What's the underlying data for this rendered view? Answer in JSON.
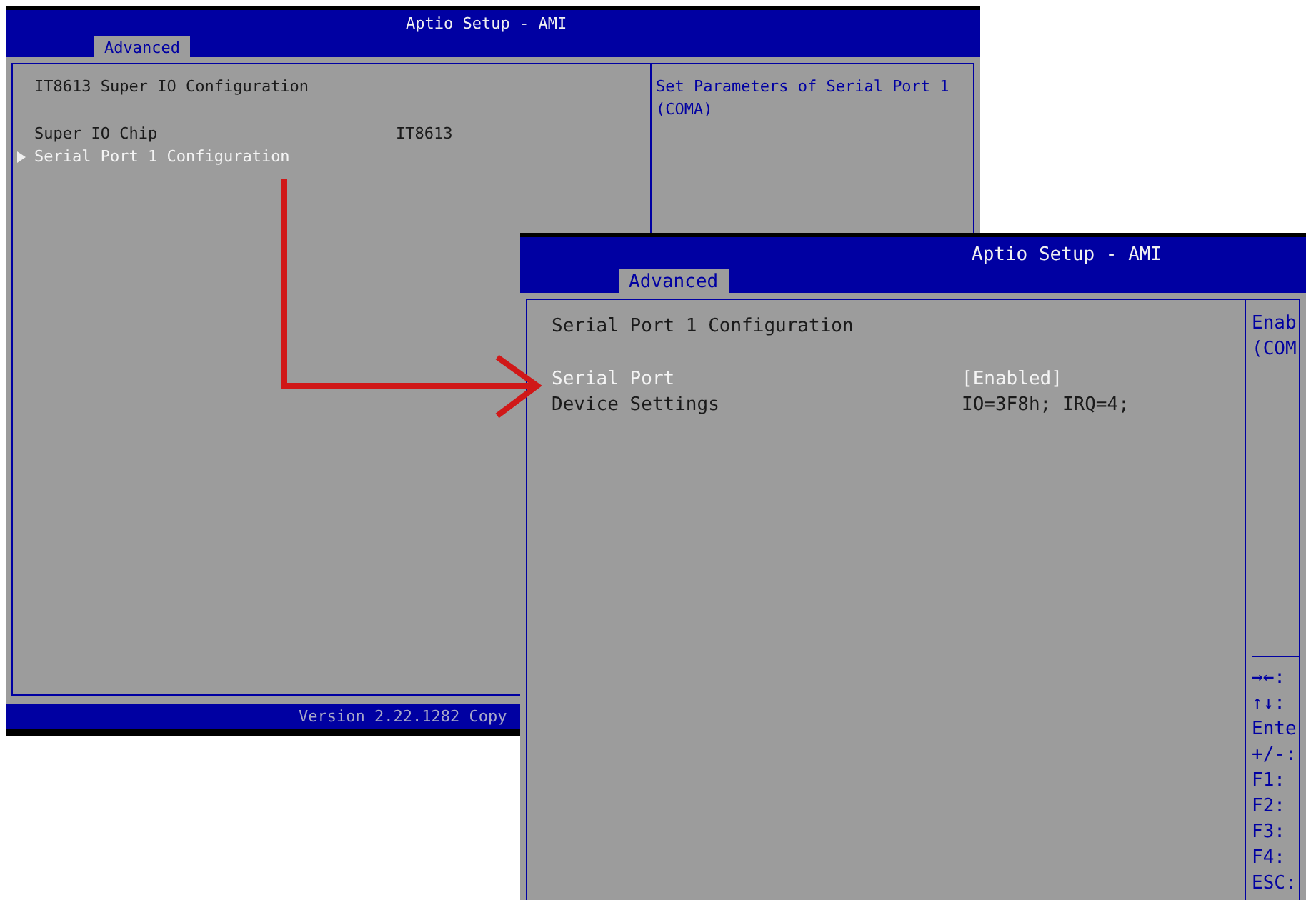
{
  "screens": [
    {
      "title": "Aptio Setup - AMI",
      "tab": {
        "label": "Advanced",
        "selected": true
      },
      "heading": "IT8613 Super IO Configuration",
      "items": [
        {
          "label": "Super IO Chip",
          "value": "IT8613",
          "submenu": false,
          "selected": false
        },
        {
          "label": "Serial Port 1 Configuration",
          "submenu": true,
          "selected": true
        }
      ],
      "help": [
        "Set Parameters of Serial Port 1 (COMA)"
      ],
      "footer": "Version 2.22.1282 Copy"
    },
    {
      "title": "Aptio Setup - AMI",
      "tab": {
        "label": "Advanced",
        "selected": true
      },
      "heading": "Serial Port 1 Configuration",
      "items": [
        {
          "label": "Serial Port",
          "value": "[Enabled]",
          "submenu": false,
          "selected": true
        },
        {
          "label": "Device Settings",
          "value": "IO=3F8h; IRQ=4;",
          "submenu": false,
          "selected": false
        }
      ],
      "help": [
        "Enab",
        "(COM"
      ],
      "keys": [
        "→←:",
        "↑↓:",
        "Ente",
        "+/-:",
        "F1:",
        "F2:",
        "F3:",
        "F4:",
        "ESC:"
      ]
    }
  ]
}
